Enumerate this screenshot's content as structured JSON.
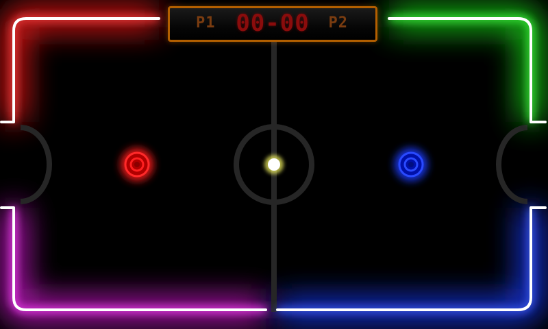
{
  "scoreboard": {
    "player1_label": "P1",
    "player2_label": "P2",
    "score": "00-00",
    "player1_score": 0,
    "player2_score": 0
  },
  "colors": {
    "player1": "#ff1a1a",
    "player2": "#1a3dff",
    "corner_top_left": "#ff1a1a",
    "corner_top_right": "#1fdc1f",
    "corner_bottom_left": "#d21ad2",
    "corner_bottom_right": "#1a3dff",
    "puck": "#ffffff",
    "field_lines": "#262626",
    "scoreboard_border": "#b35f00"
  },
  "icons": {
    "player1_mallet": "red-mallet-icon",
    "player2_mallet": "blue-mallet-icon",
    "puck": "puck-icon"
  }
}
